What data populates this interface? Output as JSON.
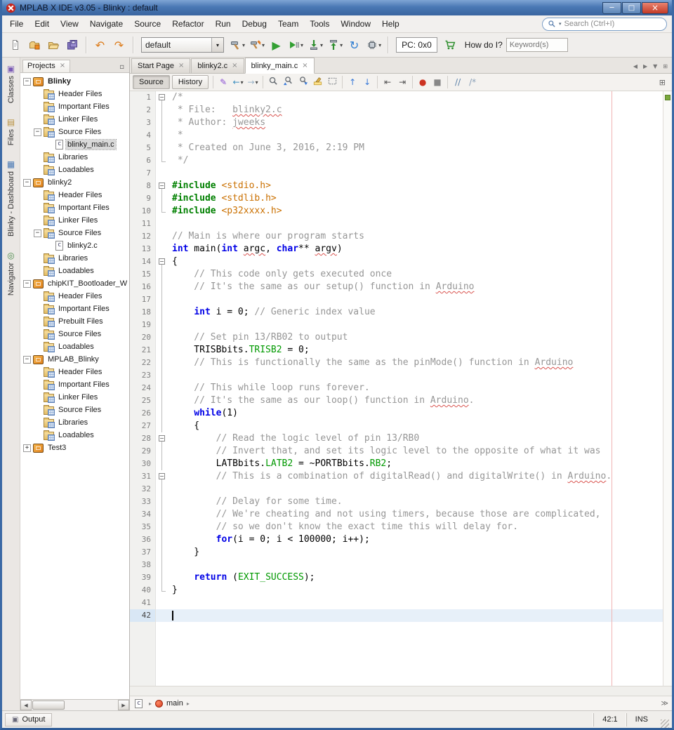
{
  "window": {
    "title": "MPLAB X IDE v3.05 - Blinky : default",
    "controls": {
      "minimize": "─",
      "maximize": "□",
      "close": "×"
    }
  },
  "colors": {
    "titlebar_blue": "#4a78b4",
    "selection_row": "#e7f0f9",
    "margin_line": "#f0b4b4",
    "comment": "#969696",
    "keyword": "#0000e6",
    "preprocessor": "#008000",
    "include_string": "#ca7000",
    "field": "#009900",
    "run_green": "#33a033",
    "undo_orange": "#dd7e1f"
  },
  "menubar": {
    "items": [
      "File",
      "Edit",
      "View",
      "Navigate",
      "Source",
      "Refactor",
      "Run",
      "Debug",
      "Team",
      "Tools",
      "Window",
      "Help"
    ],
    "search_placeholder": "Search (Ctrl+I)"
  },
  "toolbar": {
    "configuration": "default",
    "pc_label": "PC: 0x0",
    "how_do_i_label": "How do I?",
    "keyword_placeholder": "Keyword(s)",
    "caret_glyph": "▾",
    "items": [
      {
        "type": "button",
        "name": "new-file",
        "svg": "new-file"
      },
      {
        "type": "button",
        "name": "new-project",
        "svg": "new-project"
      },
      {
        "type": "button",
        "name": "open-project",
        "svg": "open-project"
      },
      {
        "type": "button",
        "name": "save-all",
        "svg": "save-all"
      },
      {
        "type": "sep"
      },
      {
        "type": "button",
        "name": "undo",
        "glyph": "↶",
        "color": "#dd7e1f"
      },
      {
        "type": "button",
        "name": "redo",
        "glyph": "↷",
        "color": "#dd7e1f"
      },
      {
        "type": "sep"
      },
      {
        "type": "combo",
        "name": "configuration-select"
      },
      {
        "type": "button",
        "name": "build-project",
        "svg": "build",
        "caret": true
      },
      {
        "type": "button",
        "name": "clean-and-build-project",
        "svg": "clean-build",
        "caret": true
      },
      {
        "type": "button",
        "name": "run-project",
        "glyph": "▶",
        "color": "#33a033"
      },
      {
        "type": "button",
        "name": "debug-project",
        "svg": "debug",
        "caret": true
      },
      {
        "type": "button",
        "name": "make-and-program-device",
        "svg": "program",
        "caret": true
      },
      {
        "type": "button",
        "name": "read-device-memory",
        "svg": "read",
        "caret": true
      },
      {
        "type": "button",
        "name": "refresh-debug-tool",
        "glyph": "↻",
        "color": "#2d7dd2"
      },
      {
        "type": "button",
        "name": "hold-in-reset",
        "svg": "chip",
        "caret": true
      },
      {
        "type": "sep"
      },
      {
        "type": "pc"
      },
      {
        "type": "button",
        "name": "microchip-store",
        "svg": "cart"
      },
      {
        "type": "howdoi"
      }
    ]
  },
  "left_tabs": [
    {
      "label": "Classes",
      "icon": "classes",
      "glyph": "▣"
    },
    {
      "label": "Files",
      "icon": "files",
      "glyph": "▤"
    },
    {
      "label": "Blinky - Dashboard",
      "icon": "dashboard",
      "glyph": "▦"
    },
    {
      "label": "Navigator",
      "icon": "navigator",
      "glyph": "◎"
    }
  ],
  "projects_panel": {
    "tab_label": "Projects",
    "close_glyph": "×",
    "minimize_glyph": "▫",
    "scroll_left_glyph": "◀",
    "scroll_right_glyph": "▶",
    "tree": [
      {
        "label": "Blinky",
        "icon": "project",
        "level": 0,
        "expand": "open",
        "bold": true
      },
      {
        "label": "Header Files",
        "icon": "folder",
        "level": 1
      },
      {
        "label": "Important Files",
        "icon": "folder",
        "level": 1
      },
      {
        "label": "Linker Files",
        "icon": "folder",
        "level": 1
      },
      {
        "label": "Source Files",
        "icon": "folder",
        "level": 1,
        "expand": "open"
      },
      {
        "label": "blinky_main.c",
        "icon": "cfile",
        "level": 2,
        "selected": true
      },
      {
        "label": "Libraries",
        "icon": "folder",
        "level": 1
      },
      {
        "label": "Loadables",
        "icon": "folder",
        "level": 1
      },
      {
        "label": "blinky2",
        "icon": "project",
        "level": 0,
        "expand": "open"
      },
      {
        "label": "Header Files",
        "icon": "folder",
        "level": 1
      },
      {
        "label": "Important Files",
        "icon": "folder",
        "level": 1
      },
      {
        "label": "Linker Files",
        "icon": "folder",
        "level": 1
      },
      {
        "label": "Source Files",
        "icon": "folder",
        "level": 1,
        "expand": "open"
      },
      {
        "label": "blinky2.c",
        "icon": "cfile",
        "level": 2
      },
      {
        "label": "Libraries",
        "icon": "folder",
        "level": 1
      },
      {
        "label": "Loadables",
        "icon": "folder",
        "level": 1
      },
      {
        "label": "chipKIT_Bootloader_W",
        "icon": "project",
        "level": 0,
        "expand": "open"
      },
      {
        "label": "Header Files",
        "icon": "folder",
        "level": 1
      },
      {
        "label": "Important Files",
        "icon": "folder",
        "level": 1
      },
      {
        "label": "Prebuilt Files",
        "icon": "folder",
        "level": 1
      },
      {
        "label": "Source Files",
        "icon": "folder",
        "level": 1
      },
      {
        "label": "Loadables",
        "icon": "folder",
        "level": 1
      },
      {
        "label": "MPLAB_Blinky",
        "icon": "project",
        "level": 0,
        "expand": "open"
      },
      {
        "label": "Header Files",
        "icon": "folder",
        "level": 1
      },
      {
        "label": "Important Files",
        "icon": "folder",
        "level": 1
      },
      {
        "label": "Linker Files",
        "icon": "folder",
        "level": 1
      },
      {
        "label": "Source Files",
        "icon": "folder",
        "level": 1
      },
      {
        "label": "Libraries",
        "icon": "folder",
        "level": 1
      },
      {
        "label": "Loadables",
        "icon": "folder",
        "level": 1
      },
      {
        "label": "Test3",
        "icon": "project",
        "level": 0,
        "expand": "closed"
      }
    ]
  },
  "editor": {
    "close_glyph": "×",
    "tabs": [
      {
        "label": "Start Page",
        "active": false
      },
      {
        "label": "blinky2.c",
        "active": false
      },
      {
        "label": "blinky_main.c",
        "active": true
      }
    ],
    "tab_controls": [
      {
        "name": "scroll-documents-left",
        "glyph": "◀"
      },
      {
        "name": "scroll-documents-right",
        "glyph": "▶"
      },
      {
        "name": "show-opened-documents-list",
        "glyph": "▼"
      },
      {
        "name": "maximize-editor",
        "glyph": "⊞"
      }
    ],
    "view_buttons": [
      {
        "label": "Source",
        "pressed": true
      },
      {
        "label": "History",
        "pressed": false
      }
    ],
    "toolbar_items": [
      {
        "type": "button",
        "name": "last-edit-location",
        "glyph": "✎",
        "color": "#8a4fd3"
      },
      {
        "type": "button",
        "name": "back",
        "glyph": "←",
        "color": "#3e8fc0",
        "caret": true
      },
      {
        "type": "button",
        "name": "forward",
        "glyph": "→",
        "color": "#9ab4c8",
        "caret": true
      },
      {
        "type": "sep"
      },
      {
        "type": "button",
        "name": "find-selection",
        "svg": "find"
      },
      {
        "type": "button",
        "name": "find-previous-occurrence",
        "svg": "find-prev"
      },
      {
        "type": "button",
        "name": "find-next-occurrence",
        "svg": "find-next"
      },
      {
        "type": "button",
        "name": "toggle-highlight-search",
        "svg": "highlight"
      },
      {
        "type": "button",
        "name": "toggle-rectangular-selection",
        "svg": "rect-select"
      },
      {
        "type": "sep"
      },
      {
        "type": "button",
        "name": "previous-bookmark",
        "glyph": "↑",
        "color": "#3a7ad9"
      },
      {
        "type": "button",
        "name": "next-bookmark",
        "glyph": "↓",
        "color": "#3a7ad9"
      },
      {
        "type": "sep"
      },
      {
        "type": "button",
        "name": "shift-line-left",
        "glyph": "⇤",
        "color": "#555555"
      },
      {
        "type": "button",
        "name": "shift-line-right",
        "glyph": "⇥",
        "color": "#555555"
      },
      {
        "type": "sep"
      },
      {
        "type": "button",
        "name": "start-macro-recording",
        "glyph": "●",
        "color": "#cc3322"
      },
      {
        "type": "button",
        "name": "stop-macro-recording",
        "glyph": "■",
        "color": "#888888"
      },
      {
        "type": "sep"
      },
      {
        "type": "button",
        "name": "toggle-comment",
        "glyph": "//",
        "color": "#5a80a8"
      },
      {
        "type": "button",
        "name": "uncomment",
        "glyph": "/*",
        "color": "#8aa0b8"
      }
    ],
    "toolbar_right_glyph": "⊞",
    "code": {
      "lines": [
        {
          "n": 1,
          "fold": "start",
          "segs": [
            [
              "cm",
              "/*"
            ]
          ]
        },
        {
          "n": 2,
          "fold": "line",
          "segs": [
            [
              "cm",
              " * File:   "
            ],
            [
              "cm",
              "blinky2.c",
              1
            ]
          ]
        },
        {
          "n": 3,
          "fold": "line",
          "segs": [
            [
              "cm",
              " * Author: "
            ],
            [
              "cm",
              "jweeks",
              1
            ]
          ]
        },
        {
          "n": 4,
          "fold": "line",
          "segs": [
            [
              "cm",
              " *"
            ]
          ]
        },
        {
          "n": 5,
          "fold": "line",
          "segs": [
            [
              "cm",
              " * Created on June 3, 2016, 2:19 PM"
            ]
          ]
        },
        {
          "n": 6,
          "fold": "end",
          "segs": [
            [
              "cm",
              " */"
            ]
          ]
        },
        {
          "n": 7,
          "segs": []
        },
        {
          "n": 8,
          "fold": "start",
          "segs": [
            [
              "pp",
              "#include "
            ],
            [
              "in",
              "<stdio.h>"
            ]
          ]
        },
        {
          "n": 9,
          "fold": "line",
          "segs": [
            [
              "pp",
              "#include "
            ],
            [
              "in",
              "<stdlib.h>"
            ]
          ]
        },
        {
          "n": 10,
          "fold": "end",
          "segs": [
            [
              "pp",
              "#include "
            ],
            [
              "in",
              "<p32xxxx.h>"
            ]
          ]
        },
        {
          "n": 11,
          "segs": []
        },
        {
          "n": 12,
          "segs": [
            [
              "cm",
              "// Main is where our program starts"
            ]
          ]
        },
        {
          "n": 13,
          "segs": [
            [
              "kw",
              "int"
            ],
            [
              "pl",
              " main("
            ],
            [
              "kw",
              "int"
            ],
            [
              "pl",
              " "
            ],
            [
              "pl",
              "argc",
              1
            ],
            [
              "pl",
              ", "
            ],
            [
              "kw",
              "char"
            ],
            [
              "pl",
              "** "
            ],
            [
              "pl",
              "argv",
              1
            ],
            [
              "pl",
              ")"
            ]
          ]
        },
        {
          "n": 14,
          "fold": "start",
          "segs": [
            [
              "pl",
              "{"
            ]
          ]
        },
        {
          "n": 15,
          "fold": "line",
          "segs": [
            [
              "cm",
              "    // This code only gets executed once"
            ]
          ]
        },
        {
          "n": 16,
          "fold": "line",
          "segs": [
            [
              "cm",
              "    // It's the same as our setup() function in "
            ],
            [
              "cm",
              "Arduino",
              1
            ]
          ]
        },
        {
          "n": 17,
          "fold": "line",
          "segs": []
        },
        {
          "n": 18,
          "fold": "line",
          "segs": [
            [
              "pl",
              "    "
            ],
            [
              "kw",
              "int"
            ],
            [
              "pl",
              " i = 0; "
            ],
            [
              "cm",
              "// Generic index value"
            ]
          ]
        },
        {
          "n": 19,
          "fold": "line",
          "segs": []
        },
        {
          "n": 20,
          "fold": "line",
          "segs": [
            [
              "cm",
              "    // Set pin 13/RB02 to output"
            ]
          ]
        },
        {
          "n": 21,
          "fold": "line",
          "segs": [
            [
              "pl",
              "    TRISBbits."
            ],
            [
              "fd",
              "TRISB2"
            ],
            [
              "pl",
              " = 0;"
            ]
          ]
        },
        {
          "n": 22,
          "fold": "line",
          "segs": [
            [
              "cm",
              "    // This is functionally the same as the pinMode() function in "
            ],
            [
              "cm",
              "Arduino",
              1
            ]
          ]
        },
        {
          "n": 23,
          "fold": "line",
          "segs": []
        },
        {
          "n": 24,
          "fold": "line",
          "segs": [
            [
              "cm",
              "    // This while loop runs forever."
            ]
          ]
        },
        {
          "n": 25,
          "fold": "line",
          "segs": [
            [
              "cm",
              "    // It's the same as our loop() function in "
            ],
            [
              "cm",
              "Arduino",
              1
            ],
            [
              "cm",
              "."
            ]
          ]
        },
        {
          "n": 26,
          "fold": "line",
          "segs": [
            [
              "pl",
              "    "
            ],
            [
              "kw",
              "while"
            ],
            [
              "pl",
              "(1)"
            ]
          ]
        },
        {
          "n": 27,
          "fold": "line",
          "segs": [
            [
              "pl",
              "    {"
            ]
          ]
        },
        {
          "n": 28,
          "fold": "start",
          "segs": [
            [
              "cm",
              "        // Read the logic level of pin 13/RB0"
            ]
          ]
        },
        {
          "n": 29,
          "fold": "line",
          "segs": [
            [
              "cm",
              "        // Invert that, and set its logic level to the opposite of what it was"
            ]
          ]
        },
        {
          "n": 30,
          "fold": "line",
          "segs": [
            [
              "pl",
              "        LATBbits."
            ],
            [
              "fd",
              "LATB2"
            ],
            [
              "pl",
              " = ~PORTBbits."
            ],
            [
              "fd",
              "RB2"
            ],
            [
              "pl",
              ";"
            ]
          ]
        },
        {
          "n": 31,
          "fold": "start",
          "segs": [
            [
              "cm",
              "        // This is a combination of digitalRead() and digitalWrite() in "
            ],
            [
              "cm",
              "Arduino",
              1
            ],
            [
              "cm",
              "."
            ]
          ]
        },
        {
          "n": 32,
          "fold": "line",
          "segs": []
        },
        {
          "n": 33,
          "fold": "line",
          "segs": [
            [
              "cm",
              "        // Delay for some time."
            ]
          ]
        },
        {
          "n": 34,
          "fold": "line",
          "segs": [
            [
              "cm",
              "        // We're cheating and not using timers, because those are complicated,"
            ]
          ]
        },
        {
          "n": 35,
          "fold": "line",
          "segs": [
            [
              "cm",
              "        // so we don't know the exact time this will delay for."
            ]
          ]
        },
        {
          "n": 36,
          "fold": "line",
          "segs": [
            [
              "pl",
              "        "
            ],
            [
              "kw",
              "for"
            ],
            [
              "pl",
              "(i = 0; i < 100000; i++);"
            ]
          ]
        },
        {
          "n": 37,
          "fold": "line",
          "segs": [
            [
              "pl",
              "    }"
            ]
          ]
        },
        {
          "n": 38,
          "fold": "line",
          "segs": []
        },
        {
          "n": 39,
          "fold": "line",
          "segs": [
            [
              "pl",
              "    "
            ],
            [
              "kw",
              "return"
            ],
            [
              "pl",
              " ("
            ],
            [
              "fd",
              "EXIT_SUCCESS"
            ],
            [
              "pl",
              ");"
            ]
          ]
        },
        {
          "n": 40,
          "fold": "end",
          "segs": [
            [
              "pl",
              "}"
            ]
          ]
        },
        {
          "n": 41,
          "segs": []
        },
        {
          "n": 42,
          "current": true,
          "segs": []
        }
      ]
    }
  },
  "breadcrumb": {
    "separator_glyph": "▸",
    "method_label": "main",
    "expand_glyph": "≫"
  },
  "statusbar": {
    "output_label": "Output",
    "output_glyph": "▣",
    "caret_position": "42:1",
    "insert_mode": "INS"
  }
}
